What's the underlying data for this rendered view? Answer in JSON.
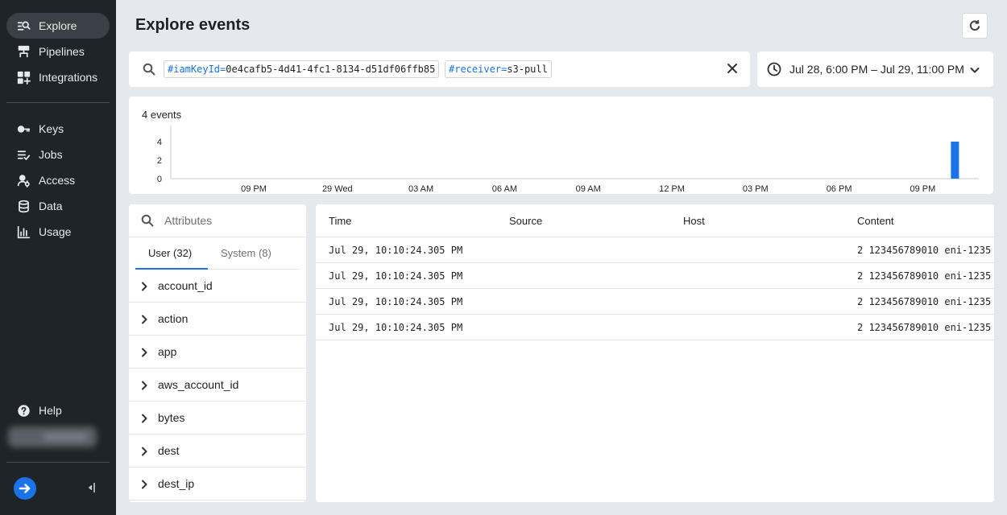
{
  "sidebar": {
    "items": [
      {
        "label": "Explore",
        "icon": "explore-icon"
      },
      {
        "label": "Pipelines",
        "icon": "pipelines-icon"
      },
      {
        "label": "Integrations",
        "icon": "integrations-icon"
      },
      {
        "label": "Keys",
        "icon": "key-icon"
      },
      {
        "label": "Jobs",
        "icon": "jobs-icon"
      },
      {
        "label": "Access",
        "icon": "access-icon"
      },
      {
        "label": "Data",
        "icon": "database-icon"
      },
      {
        "label": "Usage",
        "icon": "bar-chart-icon"
      }
    ],
    "help_label": "Help",
    "active": "Explore"
  },
  "header": {
    "title": "Explore events"
  },
  "search": {
    "filters": [
      {
        "key": "#iamKeyId",
        "op": "=",
        "value": "0e4cafb5-4d41-4fc1-8134-d51df06ffb85"
      },
      {
        "key": "#receiver",
        "op": "=",
        "value": "s3-pull"
      }
    ]
  },
  "date_range": {
    "label": "Jul 28, 6:00 PM – Jul 29, 11:00 PM"
  },
  "histogram": {
    "count_label": "4 events"
  },
  "chart_data": {
    "type": "bar",
    "y_ticks": [
      "4",
      "2",
      "0"
    ],
    "x_ticks": [
      "09 PM",
      "29 Wed",
      "03 AM",
      "06 AM",
      "09 AM",
      "12 PM",
      "03 PM",
      "06 PM",
      "09 PM"
    ],
    "bars": [
      {
        "x": "Jul 29, 10:10 PM",
        "value": 4
      }
    ],
    "ylim": [
      0,
      4
    ],
    "bar_color": "#1a73e8"
  },
  "attributes": {
    "search_placeholder": "Attributes",
    "tabs": [
      {
        "label": "User (32)"
      },
      {
        "label": "System (8)"
      }
    ],
    "items": [
      "account_id",
      "action",
      "app",
      "aws_account_id",
      "bytes",
      "dest",
      "dest_ip"
    ]
  },
  "events": {
    "columns": [
      "Time",
      "Source",
      "Host",
      "Content"
    ],
    "rows": [
      {
        "time": "Jul 29, 10:10:24.305 PM",
        "source": "",
        "host": "",
        "content": "2 123456789010 eni-1235"
      },
      {
        "time": "Jul 29, 10:10:24.305 PM",
        "source": "",
        "host": "",
        "content": "2 123456789010 eni-1235"
      },
      {
        "time": "Jul 29, 10:10:24.305 PM",
        "source": "",
        "host": "",
        "content": "2 123456789010 eni-1235"
      },
      {
        "time": "Jul 29, 10:10:24.305 PM",
        "source": "",
        "host": "",
        "content": "2 123456789010 eni-1235"
      }
    ]
  },
  "colors": {
    "accent": "#1a73e8",
    "sidebar_bg": "#1f2428",
    "page_bg": "#e5e9ed"
  }
}
